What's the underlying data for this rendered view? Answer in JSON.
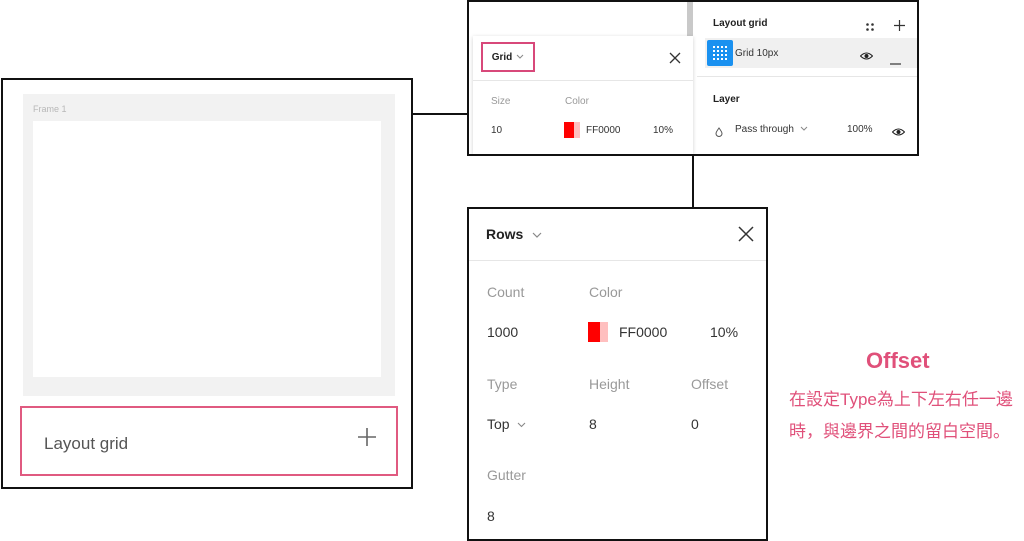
{
  "left_panel": {
    "frame_label": "Frame 1",
    "layout_grid_label": "Layout grid"
  },
  "top_panel": {
    "grid_popup": {
      "type_label": "Grid",
      "size_label": "Size",
      "color_label": "Color",
      "size_value": "10",
      "color_hex": "FF0000",
      "opacity": "10%"
    },
    "properties": {
      "layout_grid_title": "Layout grid",
      "grid_item_label": "Grid 10px",
      "layer_title": "Layer",
      "blend_mode": "Pass through",
      "layer_opacity": "100%"
    }
  },
  "rows_panel": {
    "type_label": "Rows",
    "count_label": "Count",
    "color_label": "Color",
    "count_value": "1000",
    "color_hex": "FF0000",
    "opacity": "10%",
    "type_field_label": "Type",
    "height_label": "Height",
    "offset_label": "Offset",
    "type_value": "Top",
    "height_value": "8",
    "offset_value": "0",
    "gutter_label": "Gutter",
    "gutter_value": "8"
  },
  "annotation": {
    "title": "Offset",
    "body": "在設定Type為上下左右任一邊時，與邊界之間的留白空間。"
  },
  "colors": {
    "grid_red": "#ff0000",
    "accent_pink": "#e0507a",
    "figma_blue": "#1a91f0"
  },
  "icons": [
    "plus-icon",
    "close-icon",
    "chevron-down-icon",
    "grid-icon",
    "eye-icon",
    "minus-icon",
    "drag-dots-icon",
    "blend-drop-icon"
  ]
}
